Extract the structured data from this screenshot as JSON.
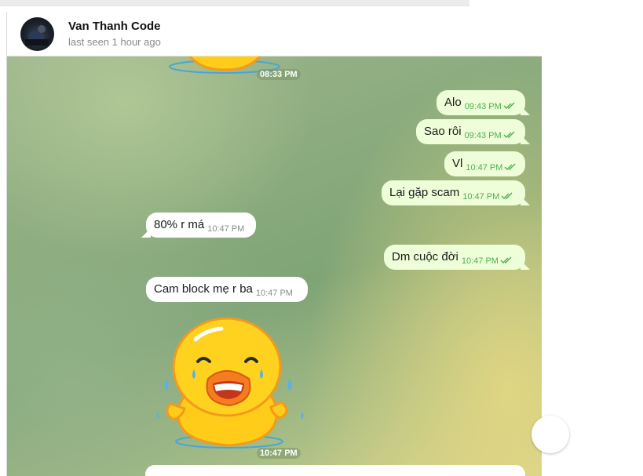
{
  "contact": {
    "name": "Van Thanh Code",
    "status": "last seen 1 hour ago"
  },
  "messages": [
    {
      "text": "Alo",
      "time": "09:43 PM",
      "direction": "outgoing",
      "read": true
    },
    {
      "text": "Sao rôi",
      "time": "09:43 PM",
      "direction": "outgoing",
      "read": true
    },
    {
      "text": "Vl",
      "time": "10:47 PM",
      "direction": "outgoing",
      "read": true
    },
    {
      "text": "Lại gặp scam",
      "time": "10:47 PM",
      "direction": "outgoing",
      "read": true
    },
    {
      "text": "80% r má",
      "time": "10:47 PM",
      "direction": "incoming"
    },
    {
      "text": "Dm cuộc đời",
      "time": "10:47 PM",
      "direction": "outgoing",
      "read": true
    },
    {
      "text": "Cam block mẹ r ba",
      "time": "10:47 PM",
      "direction": "incoming"
    }
  ],
  "stickers": [
    {
      "time": "08:33 PM",
      "icon": "duck-sticker-icon"
    },
    {
      "time": "10:47 PM",
      "icon": "laughing-duck-sticker-icon"
    }
  ],
  "colors": {
    "outgoing_bubble": "#eefed9",
    "incoming_bubble": "#ffffff",
    "outgoing_time": "#4fae4e",
    "duck_yellow": "#ffcc1a"
  }
}
